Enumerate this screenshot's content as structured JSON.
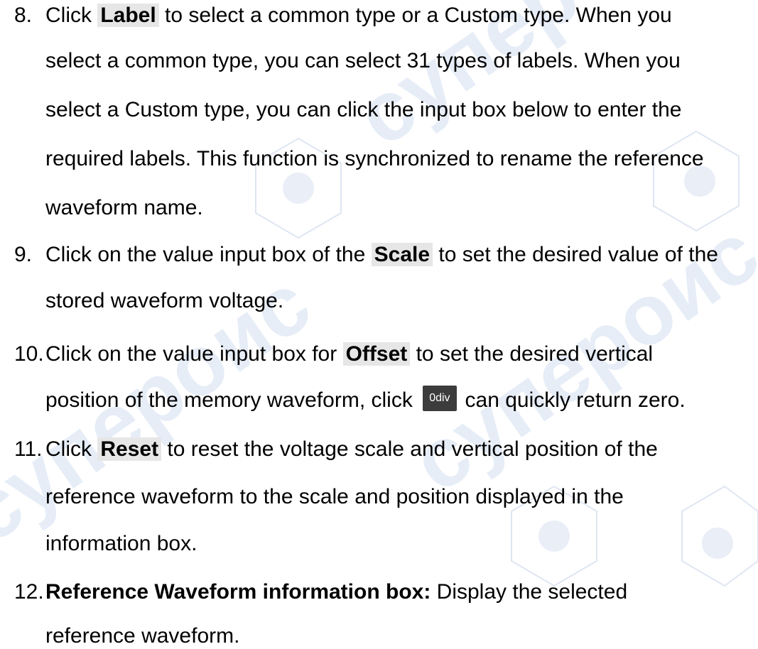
{
  "items": [
    {
      "number": "8.",
      "lines": [
        {
          "before": "Click ",
          "highlight": "Label",
          "after": " to select a common type or a Custom type. When you"
        },
        {
          "text": "select a common type, you can select 31 types of labels. When you"
        },
        {
          "text": "select a Custom type, you can click the input box below to enter the"
        },
        {
          "text": "required labels. This function is synchronized to rename the reference"
        },
        {
          "text": "waveform name."
        }
      ]
    },
    {
      "number": "9.",
      "lines": [
        {
          "before": "Click on the value input box of the ",
          "highlight": "Scale",
          "after": " to set the desired value of the"
        },
        {
          "text": "stored waveform voltage."
        }
      ]
    },
    {
      "number": "10.",
      "lines": [
        {
          "before": "Click on the value input box for ",
          "highlight": "Offset",
          "after": " to set the desired vertical"
        },
        {
          "before": "position of the memory waveform, click ",
          "button": "0div",
          "after": "can quickly return zero."
        }
      ]
    },
    {
      "number": "11.",
      "lines": [
        {
          "before": "Click ",
          "highlight": "Reset",
          "after": " to reset the voltage scale and vertical position of the"
        },
        {
          "text": "reference waveform to the scale and position displayed in the"
        },
        {
          "text": "information box."
        }
      ]
    },
    {
      "number": "12.",
      "lines": [
        {
          "bold": "Reference Waveform information box:",
          "after": " Display the selected"
        },
        {
          "text": "reference waveform."
        }
      ]
    }
  ],
  "watermark": {
    "text": "супероис",
    "color": "#dfe7f4"
  }
}
